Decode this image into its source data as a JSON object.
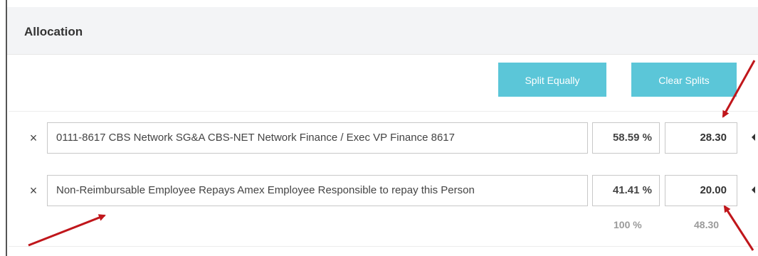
{
  "section": {
    "title": "Allocation"
  },
  "toolbar": {
    "split_equally_label": "Split Equally",
    "clear_splits_label": "Clear Splits"
  },
  "allocations": [
    {
      "remove": "×",
      "account": "0111-8617 CBS Network SG&A CBS-NET Network Finance / Exec VP Finance 8617",
      "percent": "58.59 %",
      "amount": "28.30"
    },
    {
      "remove": "×",
      "account": "Non-Reimbursable Employee Repays Amex Employee Responsible to repay this Person",
      "percent": "41.41 %",
      "amount": "20.00"
    }
  ],
  "totals": {
    "percent": "100 %",
    "amount": "48.30"
  },
  "colors": {
    "button_bg": "#5bc6d8",
    "arrow": "#c0161b",
    "header_bg": "#f3f4f6"
  }
}
